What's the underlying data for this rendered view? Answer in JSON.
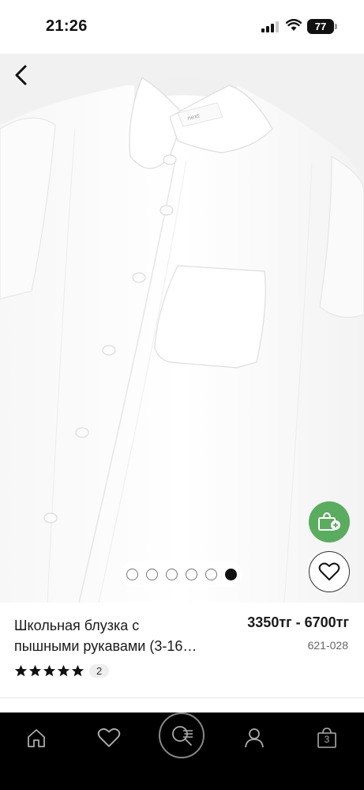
{
  "status_bar": {
    "time": "21:26",
    "battery": "77"
  },
  "product": {
    "title_line1": "Школьная блузка с",
    "title_line2": "пышными рукавами (3-16…",
    "price": "3350тг - 6700тг",
    "sku": "621-028",
    "rating": 5,
    "review_count": "2",
    "image_count": 6,
    "active_image": 6
  },
  "tab_bar": {
    "bag_count": "3",
    "items": [
      "home-icon",
      "heart-icon",
      "search-icon",
      "user-icon",
      "bag-icon"
    ]
  },
  "colors": {
    "accent_green": "#5aac5e",
    "tab_bar_bg": "#000000"
  }
}
